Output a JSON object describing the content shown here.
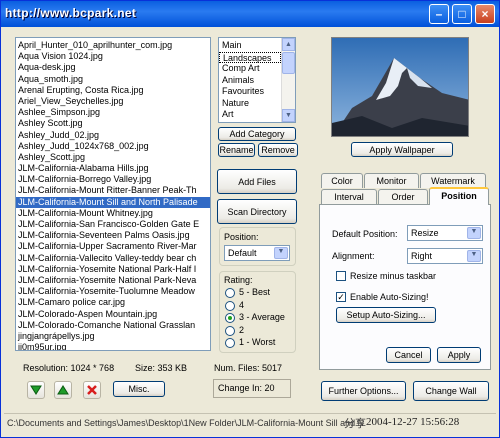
{
  "window": {
    "title": "http://www.bcpark.net"
  },
  "filelist": {
    "items": [
      "April_Hunter_010_aprilhunter_com.jpg",
      "Aqua Vision 1024.jpg",
      "Aqua-desk.jpg",
      "Aqua_smoth.jpg",
      "Arenal Erupting, Costa Rica.jpg",
      "Ariel_View_Seychelles.jpg",
      "Ashlee_Simpson.jpg",
      "Ashley Scott.jpg",
      "Ashley_Judd_02.jpg",
      "Ashley_Judd_1024x768_002.jpg",
      "Ashley_Scott.jpg",
      "JLM-California-Alabama Hills.jpg",
      "JLM-California-Borrego Valley.jpg",
      "JLM-California-Mount Ritter-Banner Peak-Th",
      "JLM-California-Mount Sill and North Palisade",
      "JLM-California-Mount Whitney.jpg",
      "JLM-California-San Francisco-Golden Gate E",
      "JLM-California-Seventeen Palms Oasis.jpg",
      "JLM-California-Upper Sacramento River-Mar",
      "JLM-California-Vallecito Valley-teddy bear ch",
      "JLM-California-Yosemite National Park-Half I",
      "JLM-California-Yosemite National Park-Neva",
      "JLM-California-Yosemite-Tuolumne Meadow",
      "JLM-Camaro police car.jpg",
      "JLM-Colorado-Aspen Mountain.jpg",
      "JLM-Colorado-Comanche National Grasslan",
      "jingjangrápellys.jpg",
      "jj0m95ur.jpg"
    ],
    "selected_index": 14
  },
  "categories": {
    "items": [
      "Main",
      "Landscapes",
      "Comp Art",
      "Animals",
      "Favourites",
      "Nature",
      "Art"
    ],
    "selected_index": 1,
    "add_label": "Add Category",
    "rename_label": "Rename",
    "remove_label": "Remove"
  },
  "actions": {
    "add_files": "Add Files",
    "scan_directory": "Scan Directory"
  },
  "position": {
    "label": "Position:",
    "value": "Default"
  },
  "rating": {
    "label": "Rating:",
    "options": [
      "5 - Best",
      "4",
      "3 - Average",
      "2",
      "1 - Worst"
    ],
    "selected_index": 2
  },
  "info": {
    "resolution": "Resolution: 1024 * 768",
    "size": "Size: 353 KB",
    "num_files": "Num. Files: 5017",
    "change_in": "Change In: 20",
    "misc_label": "Misc."
  },
  "preview": {
    "apply_wallpaper": "Apply Wallpaper"
  },
  "tabs": {
    "row1": [
      "Color",
      "Monitor",
      "Watermark"
    ],
    "row2": [
      "Interval",
      "Order",
      "Position"
    ],
    "active": "Position"
  },
  "position_tab": {
    "default_position_label": "Default Position:",
    "default_position_value": "Resize",
    "alignment_label": "Alignment:",
    "alignment_value": "Right",
    "resize_minus_taskbar": "Resize minus taskbar",
    "resize_minus_taskbar_checked": false,
    "enable_auto_sizing": "Enable Auto-Sizing!",
    "enable_auto_sizing_checked": true,
    "setup_auto_sizing": "Setup Auto-Sizing...",
    "cancel": "Cancel",
    "apply": "Apply"
  },
  "bottom": {
    "further_options": "Further Options...",
    "change_wall": "Change Wall"
  },
  "status": {
    "path": "C:\\Documents and Settings\\James\\Desktop\\1New Folder\\JLM-California-Mount Sill and N",
    "timestamp": "2004-12-27 15:56:28",
    "watermark": "分享"
  },
  "colors": {
    "selection": "#316ac5",
    "titlebar": "#0a5fe0",
    "face": "#ece9d8"
  }
}
